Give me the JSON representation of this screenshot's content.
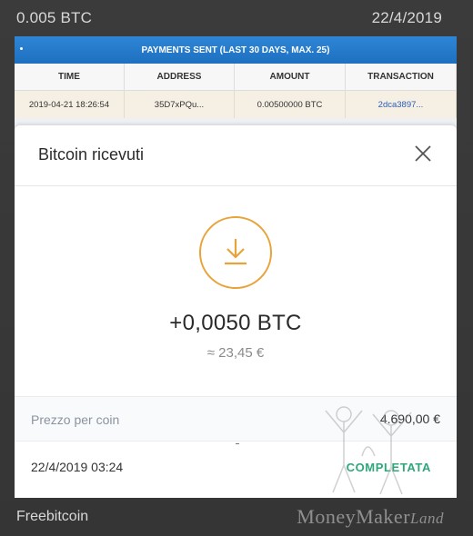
{
  "caption": {
    "top_left": "0.005 BTC",
    "top_right": "22/4/2019",
    "bottom_left": "Freebitcoin",
    "brand_main": "MoneyMaker",
    "brand_sub": "Land"
  },
  "payments_table": {
    "header": "PAYMENTS SENT (LAST 30 DAYS, MAX. 25)",
    "columns": [
      "TIME",
      "ADDRESS",
      "AMOUNT",
      "TRANSACTION"
    ],
    "rows": [
      {
        "time": "2019-04-21 18:26:54",
        "address": "35D7xPQu...",
        "amount": "0.00500000 BTC",
        "transaction": "2dca3897..."
      }
    ]
  },
  "modal": {
    "title": "Bitcoin ricevuti",
    "amount": "+0,0050 BTC",
    "fiat": "≈ 23,45 €",
    "price_label": "Prezzo per coin",
    "price_value": "4.690,00 €",
    "date": "22/4/2019 03:24",
    "status": "COMPLETATA"
  },
  "colors": {
    "accent_orange": "#e8a33a",
    "status_green": "#2ea77a",
    "header_blue": "#1e6fc0"
  },
  "icons": [
    "close-icon",
    "download-arrow-icon",
    "watermark-figures-icon"
  ]
}
